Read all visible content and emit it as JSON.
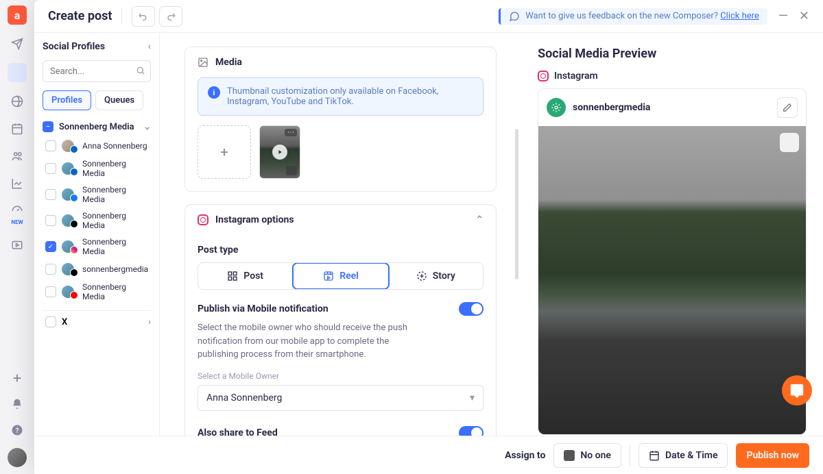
{
  "header": {
    "title": "Create post",
    "banner_text": "Want to give us feedback on the new Composer? ",
    "banner_link": "Click here"
  },
  "sidebar": {
    "title": "Social Profiles",
    "search_placeholder": "Search...",
    "tab_profiles": "Profiles",
    "tab_queues": "Queues",
    "group_name": "Sonnenberg Media",
    "profiles": [
      {
        "name": "Anna Sonnenberg",
        "platform": "linkedin",
        "checked": false
      },
      {
        "name": "Sonnenberg Media",
        "platform": "linkedin",
        "checked": false
      },
      {
        "name": "Sonnenberg Media",
        "platform": "facebook",
        "checked": false
      },
      {
        "name": "Sonnenberg Media",
        "platform": "threads",
        "checked": false
      },
      {
        "name": "Sonnenberg Media",
        "platform": "instagram",
        "checked": true
      },
      {
        "name": "sonnenbergmedia",
        "platform": "tiktok",
        "checked": false
      },
      {
        "name": "Sonnenberg Media",
        "platform": "youtube",
        "checked": false
      }
    ],
    "x_label": "X"
  },
  "media": {
    "heading": "Media",
    "info": "Thumbnail customization only available on Facebook, Instagram, YouTube and TikTok."
  },
  "instagram": {
    "heading": "Instagram options",
    "post_type_label": "Post type",
    "types": {
      "post": "Post",
      "reel": "Reel",
      "story": "Story"
    },
    "publish_label": "Publish via Mobile notification",
    "publish_help": "Select the mobile owner who should receive the push notification from our mobile app to complete the publishing process from their smartphone.",
    "owner_label": "Select a Mobile Owner",
    "owner_value": "Anna Sonnenberg",
    "share_feed_label": "Also share to Feed"
  },
  "preview": {
    "title": "Social Media Preview",
    "platform": "Instagram",
    "account": "sonnenbergmedia"
  },
  "footer": {
    "assign_label": "Assign to",
    "assign_value": "No one",
    "datetime": "Date & Time",
    "publish": "Publish now"
  },
  "leftrail": {
    "new": "NEW"
  }
}
